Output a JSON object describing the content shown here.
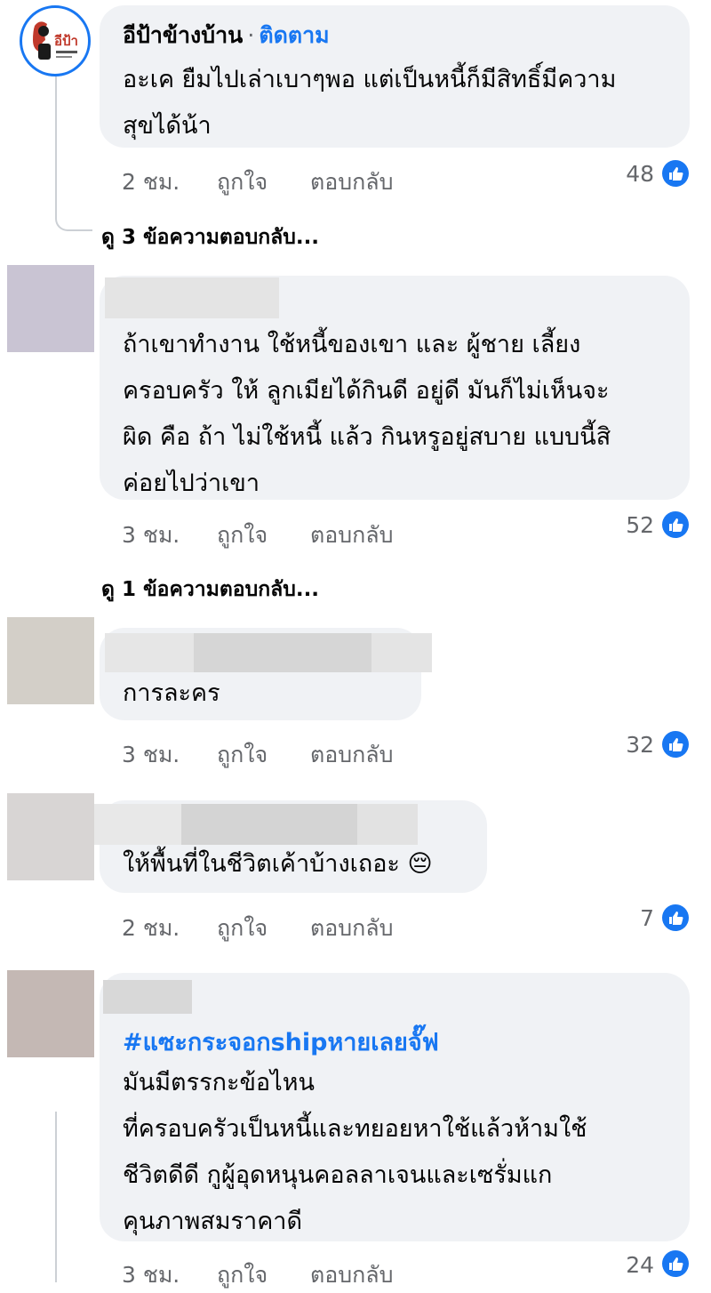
{
  "colors": {
    "accent": "#1877f2",
    "bubble": "#f0f2f5",
    "meta": "#65676b"
  },
  "comments": [
    {
      "author": "อีป้าข้างบ้าน",
      "separator": "·",
      "follow_label": "ติดตาม",
      "lines": [
        "อะเค ยืมไปเล่าเบาๆพอ แต่เป็นหนี้ก็มีสิทธิ์มีความ",
        "สุขได้น้า"
      ],
      "time": "2 ชม.",
      "like_label": "ถูกใจ",
      "reply_label": "ตอบกลับ",
      "like_count": "48",
      "view_replies": "ดู 3 ข้อความตอบกลับ..."
    },
    {
      "lines": [
        "ถ้าเขาทำงาน ใช้หนี้ของเขา และ ผู้ชาย เลี้ยง",
        "ครอบครัว ให้ ลูกเมียได้กินดี อยู่ดี มันก็ไม่เห็นจะ",
        "ผิด คือ ถ้า ไม่ใช้หนี้ แล้ว กินหรูอยู่สบาย แบบนี้สิ",
        "ค่อยไปว่าเขา"
      ],
      "time": "3 ชม.",
      "like_label": "ถูกใจ",
      "reply_label": "ตอบกลับ",
      "like_count": "52",
      "view_replies": "ดู 1 ข้อความตอบกลับ..."
    },
    {
      "lines": [
        "การละคร"
      ],
      "time": "3 ชม.",
      "like_label": "ถูกใจ",
      "reply_label": "ตอบกลับ",
      "like_count": "32"
    },
    {
      "lines": [
        "ให้พื้นที่ในชีวิตเค้าบ้างเถอะ"
      ],
      "emoji": "😔",
      "time": "2 ชม.",
      "like_label": "ถูกใจ",
      "reply_label": "ตอบกลับ",
      "like_count": "7"
    },
    {
      "hashtag": "#แซะกระจอกshipหายเลยจั๊ฟ",
      "lines": [
        "มันมีตรรกะข้อไหน",
        "ที่ครอบครัวเป็นหนี้และทยอยหาใช้แล้วห้ามใช้",
        "ชีวิตดีดี กูผู้อุดหนุนคอลลาเจนและเซรั่มแก",
        "คุนภาพสมราคาดี"
      ],
      "time": "3 ชม.",
      "like_label": "ถูกใจ",
      "reply_label": "ตอบกลับ",
      "like_count": "24"
    }
  ],
  "avatar_logo_text": "อีป้า"
}
